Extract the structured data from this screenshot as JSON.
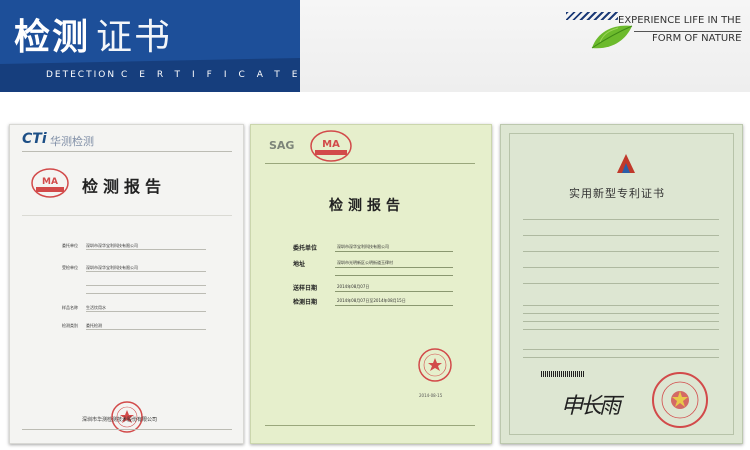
{
  "header": {
    "title_bold": "检测",
    "title_light": "证书",
    "subtitle_a": "DETECTION",
    "subtitle_b": "CERTIFICATE",
    "slogan_line1": "EXPERIENCE LIFE IN THE",
    "slogan_line2": "FORM OF NATURE"
  },
  "colors": {
    "banner_blue": "#1d4f99",
    "banner_dark": "#163e7d",
    "leaf_green": "#6cba2c"
  },
  "certificates": [
    {
      "logo_text": "CTi",
      "logo_cn": "华测检测",
      "title": "检测报告",
      "rows": [
        "委托单位",
        "受检单位",
        "样品名称",
        "检测类别"
      ],
      "values": [
        "深圳市深华宝利科技有限公司",
        "深圳市深华宝利科技有限公司",
        "生活饮用水",
        "委托检测"
      ],
      "footer": "深圳市华测检测技术股份有限公司"
    },
    {
      "logo_text": "SAG",
      "title": "检测报告",
      "rows": [
        "委托单位",
        "地址",
        "送样日期",
        "检测日期"
      ],
      "values": [
        "深圳市深华宝利科技有限公司",
        "深圳市光明新区公明街道玉律村",
        "2014年08月07日",
        "2014年08月07日至2014年08月15日"
      ],
      "date": "2014-08-15"
    },
    {
      "title": "实用新型专利证书",
      "signature": "申长雨"
    }
  ]
}
